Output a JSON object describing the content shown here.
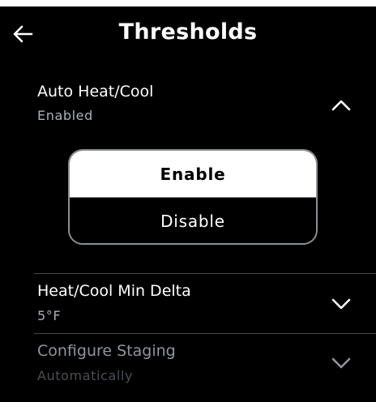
{
  "header": {
    "title": "Thresholds",
    "back_icon": "arrow-left-icon"
  },
  "auto_heat_cool": {
    "label": "Auto Heat/Cool",
    "value": "Enabled",
    "expanded": true,
    "chevron_icon": "chevron-up-icon",
    "options": [
      {
        "label": "Enable",
        "selected": true
      },
      {
        "label": "Disable",
        "selected": false
      }
    ]
  },
  "min_delta": {
    "label": "Heat/Cool Min Delta",
    "value": "5°F",
    "chevron_icon": "chevron-down-icon"
  },
  "configure_staging": {
    "label": "Configure Staging",
    "value": "Automatically",
    "disabled": true,
    "chevron_icon": "chevron-down-icon"
  },
  "colors": {
    "background": "#000000",
    "text": "#ffffff",
    "subtext": "#a9b0b8",
    "selected_bg": "#ffffff",
    "border": "#8a9096"
  }
}
